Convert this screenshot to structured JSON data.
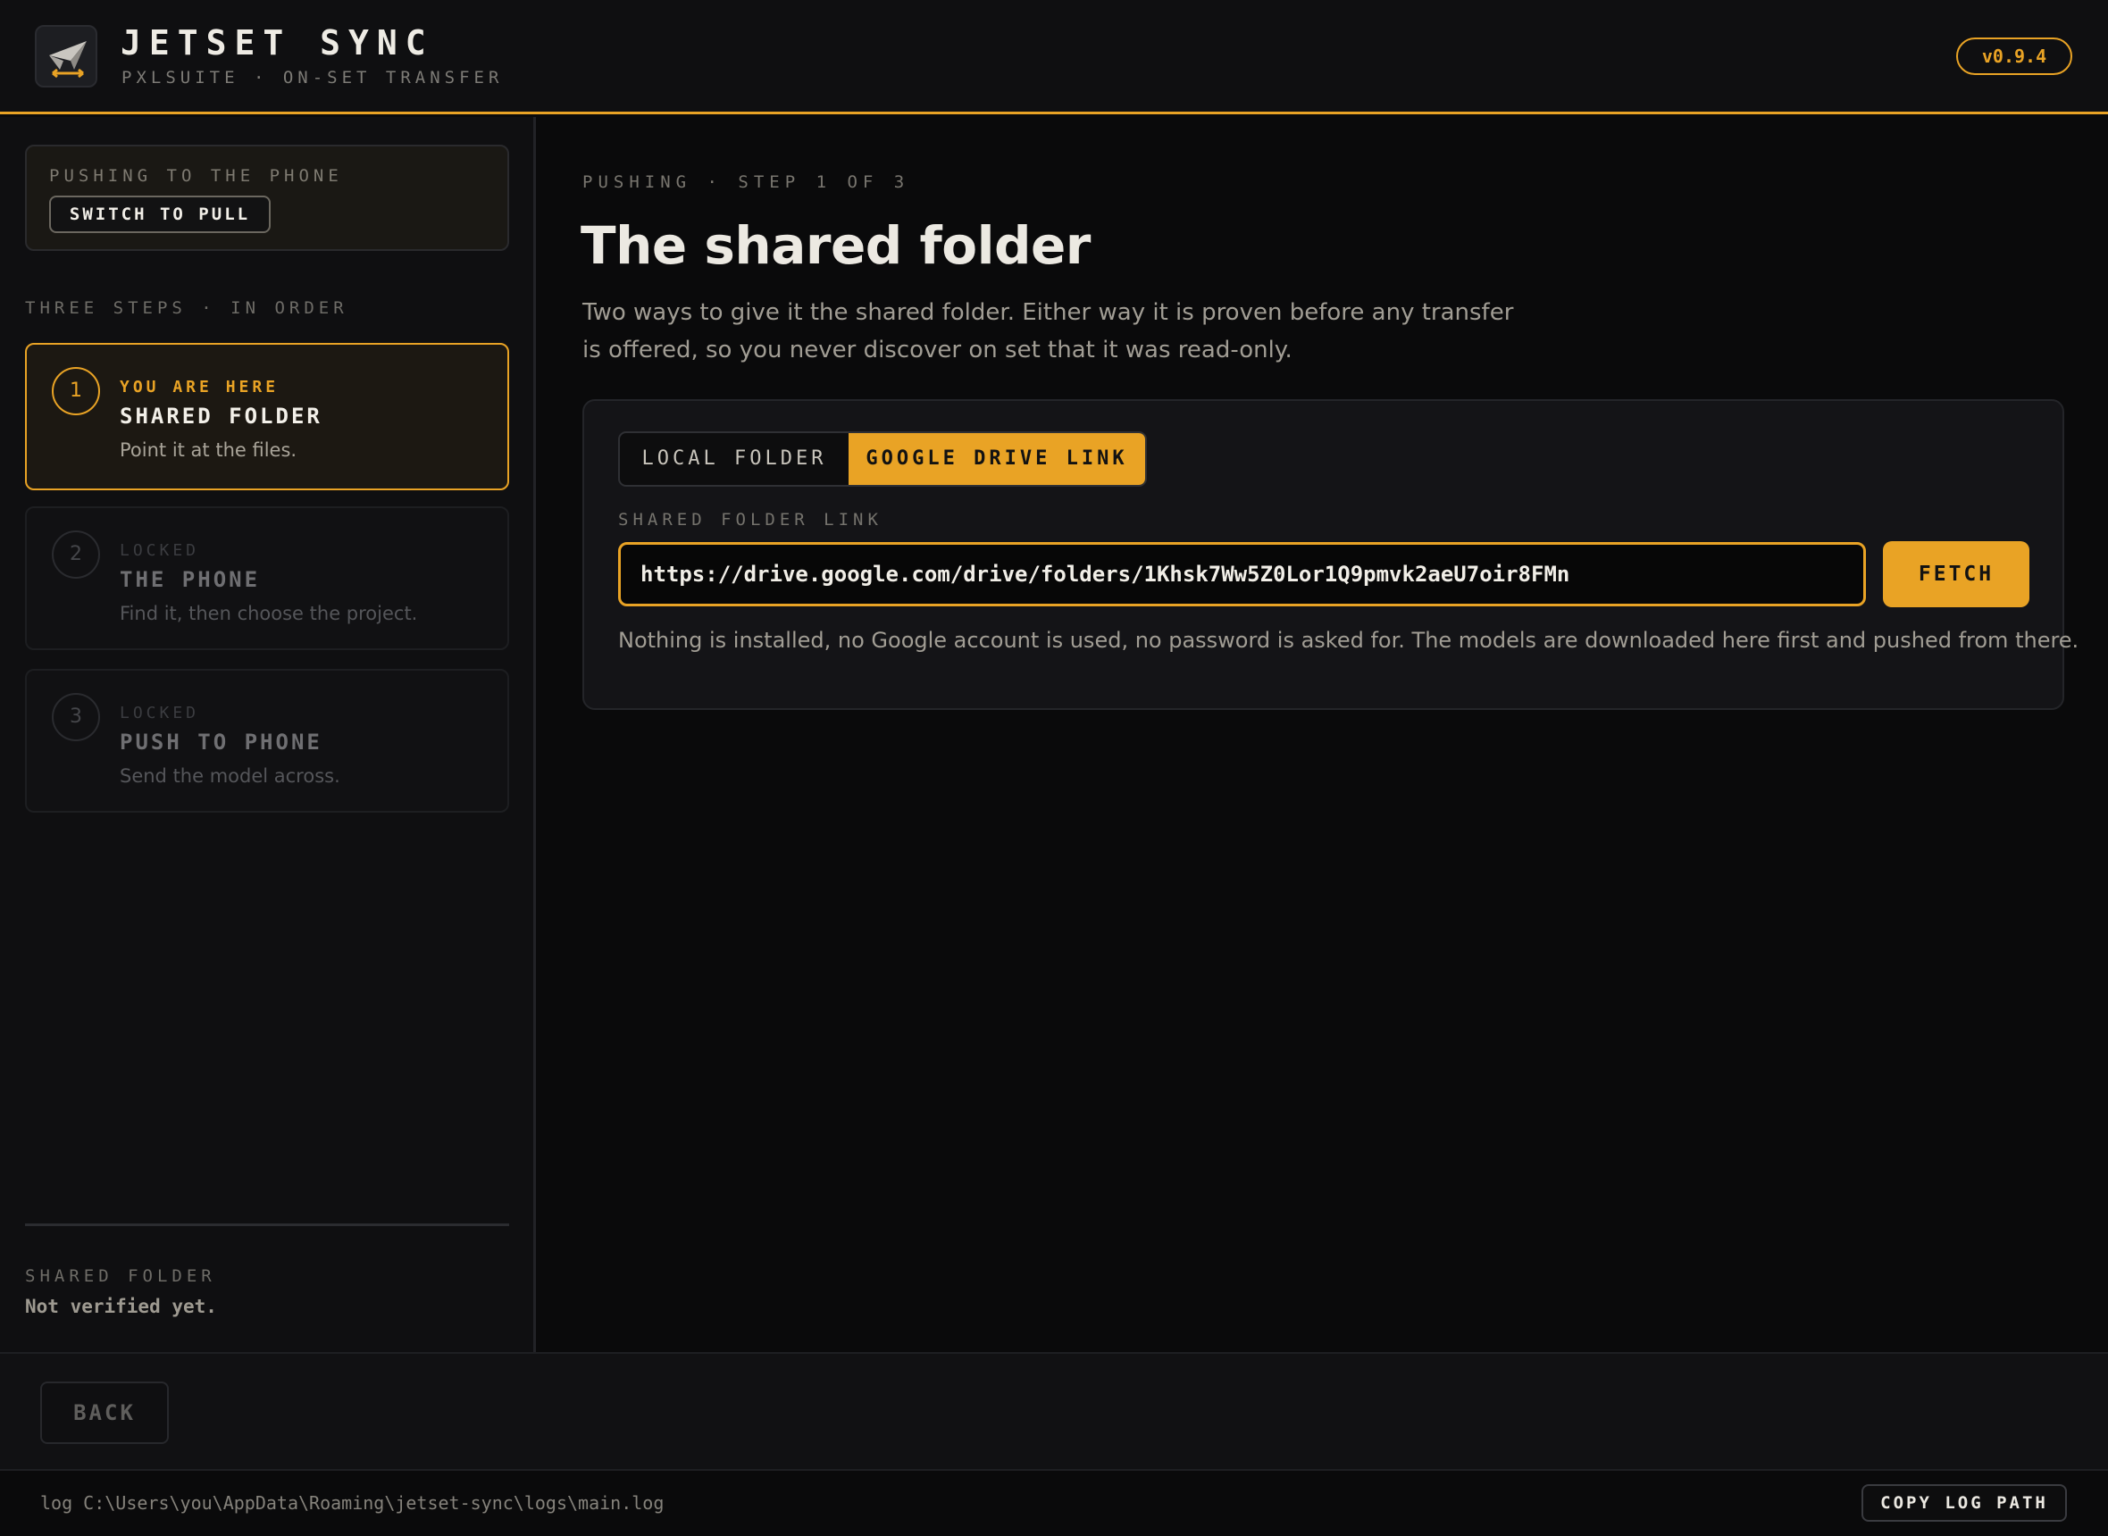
{
  "app": {
    "title": "JETSET SYNC",
    "subtitle": "PXLSUITE · ON-SET TRANSFER",
    "version": "v0.9.4",
    "logo_icon": "paper-plane-icon"
  },
  "colors": {
    "accent": "#e9a325",
    "background": "#0a0a0b",
    "panel": "#141417"
  },
  "sidebar": {
    "mode_label": "PUSHING TO THE PHONE",
    "switch_label": "SWITCH TO PULL",
    "steps_heading": "THREE STEPS · IN ORDER",
    "steps": [
      {
        "number": "1",
        "status": "YOU ARE HERE",
        "title": "SHARED FOLDER",
        "description": "Point it at the files.",
        "state": "active"
      },
      {
        "number": "2",
        "status": "LOCKED",
        "title": "THE PHONE",
        "description": "Find it, then choose the project.",
        "state": "locked"
      },
      {
        "number": "3",
        "status": "LOCKED",
        "title": "PUSH TO PHONE",
        "description": "Send the model across.",
        "state": "locked"
      }
    ],
    "footer_label": "SHARED FOLDER",
    "footer_value": "Not verified yet."
  },
  "main": {
    "eyebrow": "PUSHING · STEP 1 OF 3",
    "title": "The shared folder",
    "lede": "Two ways to give it the shared folder. Either way it is proven before any transfer is offered, so you never discover on set that it was read-only.",
    "tabs": [
      {
        "label": "LOCAL FOLDER",
        "selected": false
      },
      {
        "label": "GOOGLE DRIVE LINK",
        "selected": true
      }
    ],
    "field_label": "SHARED FOLDER LINK",
    "link_value": "https://drive.google.com/drive/folders/1Khsk7Ww5Z0Lor1Q9pmvk2aeU7oir8FMn",
    "fetch_label": "FETCH",
    "note": "Nothing is installed, no Google account is used, no password is asked for. The models are downloaded here first and pushed from there."
  },
  "actions": {
    "back_label": "BACK"
  },
  "log": {
    "path": "log C:\\Users\\you\\AppData\\Roaming\\jetset-sync\\logs\\main.log",
    "copy_label": "COPY LOG PATH"
  }
}
